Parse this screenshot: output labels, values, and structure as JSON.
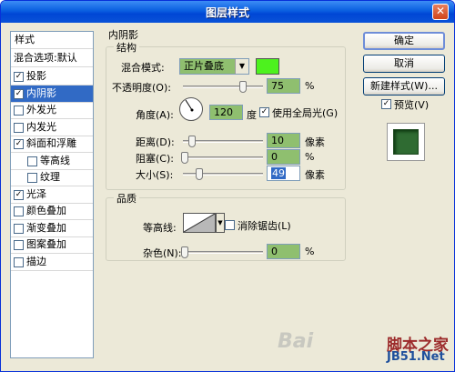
{
  "window": {
    "title": "图层样式",
    "close_glyph": "✕"
  },
  "stylelist": {
    "header": "样式",
    "blend_options": "混合选项:默认",
    "items": [
      {
        "label": "投影",
        "checked": true,
        "indent": false,
        "selected": false
      },
      {
        "label": "内阴影",
        "checked": true,
        "indent": false,
        "selected": true
      },
      {
        "label": "外发光",
        "checked": false,
        "indent": false,
        "selected": false
      },
      {
        "label": "内发光",
        "checked": false,
        "indent": false,
        "selected": false
      },
      {
        "label": "斜面和浮雕",
        "checked": true,
        "indent": false,
        "selected": false
      },
      {
        "label": "等高线",
        "checked": false,
        "indent": true,
        "selected": false
      },
      {
        "label": "纹理",
        "checked": false,
        "indent": true,
        "selected": false
      },
      {
        "label": "光泽",
        "checked": true,
        "indent": false,
        "selected": false
      },
      {
        "label": "颜色叠加",
        "checked": false,
        "indent": false,
        "selected": false
      },
      {
        "label": "渐变叠加",
        "checked": false,
        "indent": false,
        "selected": false
      },
      {
        "label": "图案叠加",
        "checked": false,
        "indent": false,
        "selected": false
      },
      {
        "label": "描边",
        "checked": false,
        "indent": false,
        "selected": false
      }
    ],
    "check_glyph": "✓"
  },
  "panel": {
    "section_title": "内阴影",
    "structure": {
      "title": "结构",
      "blend_mode_label": "混合模式:",
      "blend_mode_value": "正片叠底",
      "blend_color": "#4DF21E",
      "opacity_label": "不透明度(O):",
      "opacity_value": "75",
      "opacity_unit": "%",
      "opacity_level": 0.75,
      "angle_label": "角度(A):",
      "angle_value": "120",
      "angle_unit": "度",
      "global_light_label": "使用全局光(G)",
      "global_light_checked": true,
      "distance_label": "距离(D):",
      "distance_value": "10",
      "distance_unit": "像素",
      "choke_label": "阻塞(C):",
      "choke_value": "0",
      "choke_unit": "%",
      "size_label": "大小(S):",
      "size_value": "49",
      "size_unit": "像素"
    },
    "quality": {
      "title": "品质",
      "contour_label": "等高线:",
      "antialias_label": "消除锯齿(L)",
      "antialias_checked": false,
      "noise_label": "杂色(N):",
      "noise_value": "0",
      "noise_unit": "%"
    }
  },
  "buttons": {
    "ok": "确定",
    "cancel": "取消",
    "new_style": "新建样式(W)...",
    "preview_label": "预览(V)",
    "preview_checked": true
  },
  "watermark": {
    "baidu": "Bai",
    "site_cn": "脚本之家",
    "site_url": "JB51.Net"
  }
}
